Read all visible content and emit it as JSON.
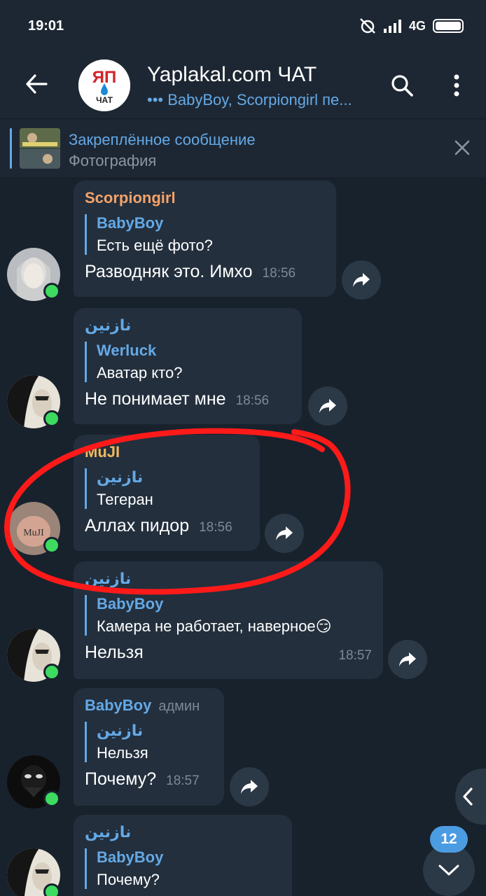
{
  "status": {
    "time": "19:01",
    "network": "4G"
  },
  "header": {
    "title": "Yaplakal.com ЧАТ",
    "subtitle": "••• BabyBoy, Scorpiongirl пе...",
    "logo_text_top": "ЯП",
    "logo_text_bottom": "ЧАТ"
  },
  "pinned": {
    "title": "Закреплённое сообщение",
    "text": "Фотография"
  },
  "colors": {
    "accent": "#64a9e6",
    "online": "#3ddc60",
    "annotation": "#ff1a1a"
  },
  "messages": [
    {
      "sender": "Scorpiongirl",
      "sender_color": "#f5a36a",
      "reply_name": "BabyBoy",
      "reply_text": "Есть ещё фото?",
      "text": "Разводняк это. Имхо",
      "time": "18:56"
    },
    {
      "sender": "نازنین",
      "sender_color": "#64a9e6",
      "reply_name": "Werluck",
      "reply_text": "Аватар кто?",
      "text": "Не понимает мне",
      "time": "18:56"
    },
    {
      "sender": "MuJI",
      "sender_color": "#f0b95c",
      "reply_name": "نازنین",
      "reply_text": "Тегеран",
      "text": "Аллах пидор",
      "time": "18:56"
    },
    {
      "sender": "نازنین",
      "sender_color": "#64a9e6",
      "reply_name": "BabyBoy",
      "reply_text": "Камера не работает, наверное😏",
      "text": "Нельзя",
      "time": "18:57"
    },
    {
      "sender": "BabyBoy",
      "sender_color": "#64a9e6",
      "sender_badge": "админ",
      "reply_name": "نازنین",
      "reply_text": "Нельзя",
      "text": "Почему?",
      "time": "18:57"
    },
    {
      "sender": "نازنین",
      "sender_color": "#64a9e6",
      "reply_name": "BabyBoy",
      "reply_text": "Почему?",
      "text": "",
      "time": ""
    }
  ],
  "unread_count": "12"
}
